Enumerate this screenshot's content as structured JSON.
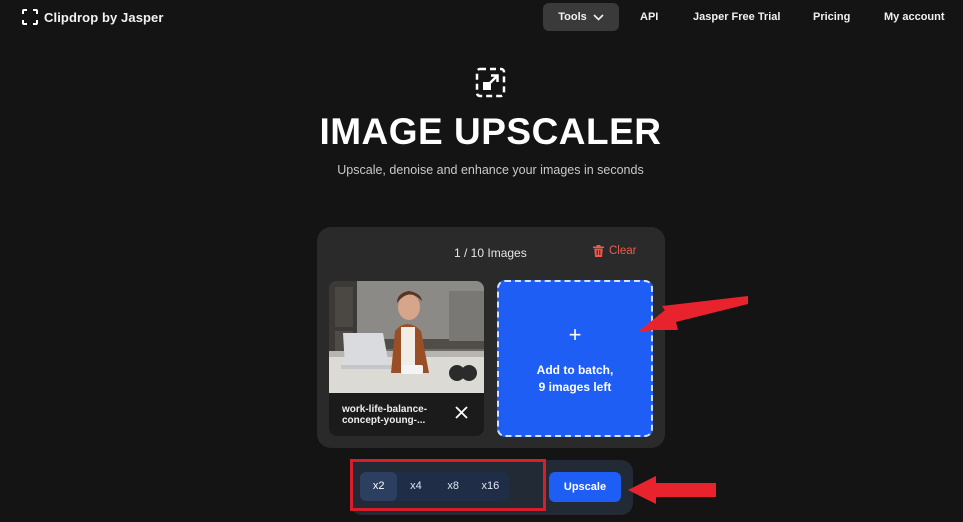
{
  "header": {
    "logo_text": "Clipdrop by Jasper",
    "nav": {
      "tools": "Tools",
      "api": "API",
      "trial": "Jasper Free Trial",
      "pricing": "Pricing",
      "account": "My account"
    }
  },
  "hero": {
    "title": "IMAGE UPSCALER",
    "subtitle": "Upscale, denoise and enhance your images in seconds"
  },
  "batch": {
    "count": "1 / 10 Images",
    "clear_label": "Clear",
    "thumbnail_name_line1": "work-life-balance-",
    "thumbnail_name_line2": "concept-young-...",
    "add_plus": "+",
    "add_line1": "Add to batch,",
    "add_line2": "9 images left"
  },
  "scale": {
    "options": [
      "x2",
      "x4",
      "x8",
      "x16"
    ],
    "selected": "x2"
  },
  "upscale_label": "Upscale",
  "colors": {
    "background": "#141414",
    "accent_blue": "#1e5ef4",
    "clear_red": "#ef5a4a",
    "annotation_red": "#d81e2a"
  }
}
